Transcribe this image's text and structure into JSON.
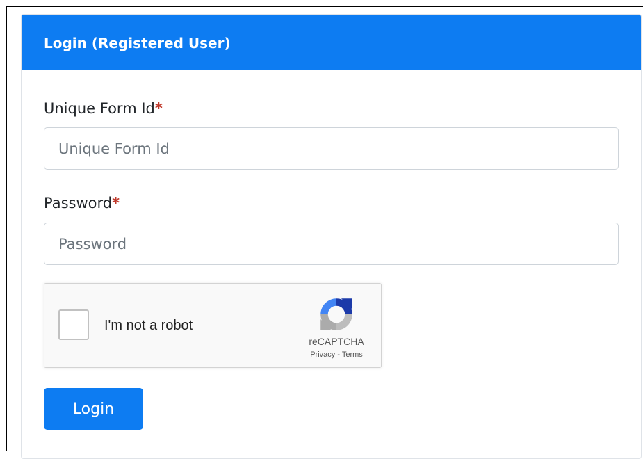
{
  "card": {
    "title": "Login (Registered User)"
  },
  "fields": {
    "form_id": {
      "label": "Unique Form Id",
      "required_mark": "*",
      "placeholder": "Unique Form Id",
      "value": ""
    },
    "password": {
      "label": "Password",
      "required_mark": "*",
      "placeholder": "Password",
      "value": ""
    }
  },
  "captcha": {
    "checkbox_label": "I'm not a robot",
    "checked": false,
    "brand": "reCAPTCHA",
    "privacy_link": "Privacy",
    "separator": " - ",
    "terms_link": "Terms",
    "icon": "recaptcha-logo-icon"
  },
  "actions": {
    "login_label": "Login"
  },
  "colors": {
    "primary": "#0d7cf2",
    "required": "#c0392b",
    "border": "#ced4da"
  }
}
